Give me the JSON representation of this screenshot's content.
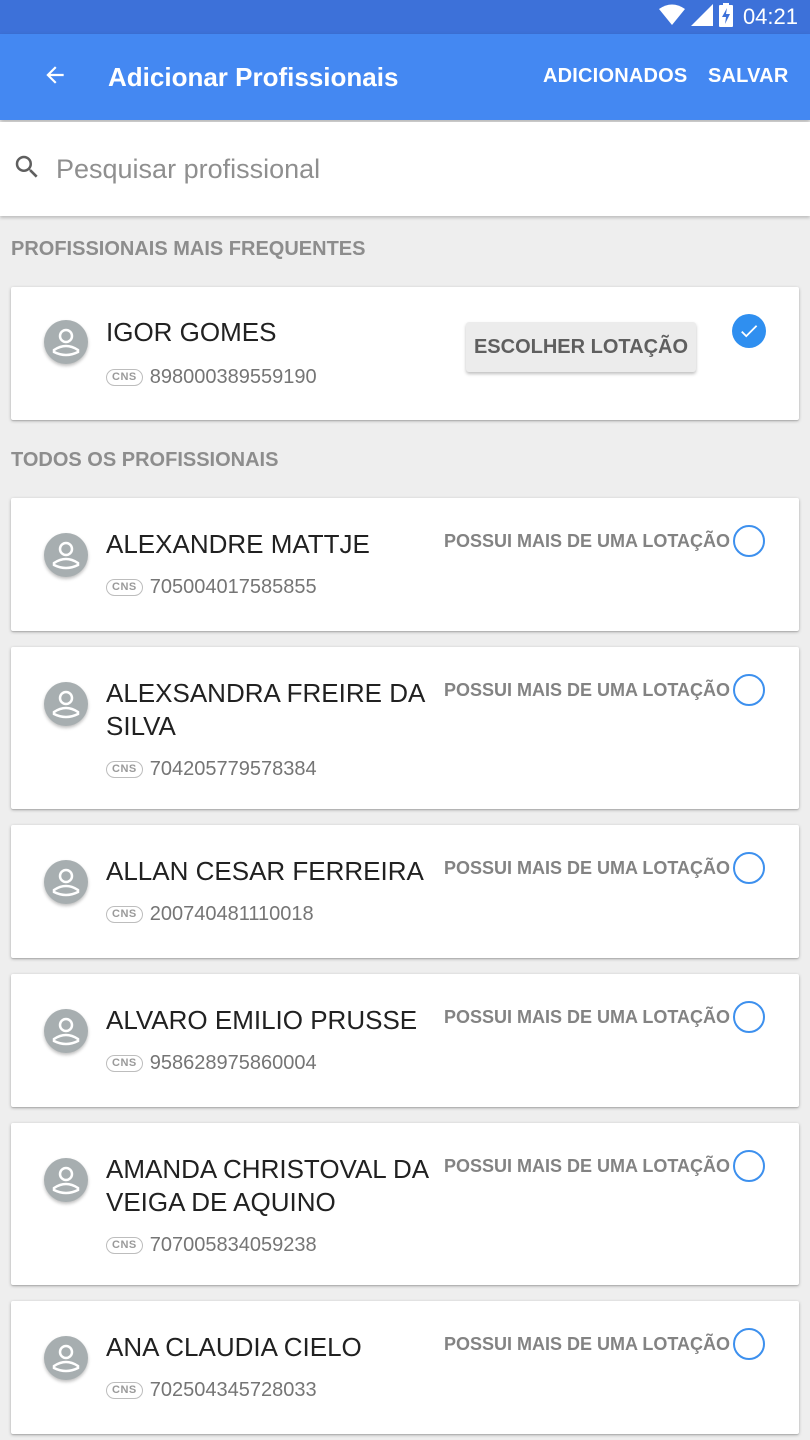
{
  "status_bar": {
    "time": "04:21",
    "icons": [
      "wifi-icon",
      "signal-icon",
      "battery-charging-icon"
    ]
  },
  "app_bar": {
    "back_icon": "arrow-back-icon",
    "title": "Adicionar Profissionais",
    "actions": {
      "added": "ADICIONADOS",
      "save": "SALVAR"
    }
  },
  "search": {
    "icon": "search-icon",
    "placeholder": "Pesquisar profissional",
    "value": ""
  },
  "frequent": {
    "header": "PROFISSIONAIS MAIS FREQUENTES",
    "items": [
      {
        "name": "IGOR GOMES",
        "cns_label": "CNS",
        "cns": "898000389559190",
        "button": "ESCOLHER LOTAÇÃO",
        "selected": true
      }
    ]
  },
  "all": {
    "header": "TODOS OS PROFISSIONAIS",
    "multi_label": "POSSUI MAIS DE UMA LOTAÇÃO",
    "cns_label": "CNS",
    "items": [
      {
        "name": "ALEXANDRE MATTJE",
        "cns": "705004017585855",
        "selected": false
      },
      {
        "name": "ALEXSANDRA FREIRE DA SILVA",
        "cns": "704205779578384",
        "selected": false
      },
      {
        "name": "ALLAN CESAR FERREIRA",
        "cns": "200740481110018",
        "selected": false
      },
      {
        "name": "ALVARO EMILIO PRUSSE",
        "cns": "958628975860004",
        "selected": false
      },
      {
        "name": "AMANDA CHRISTOVAL DA VEIGA DE AQUINO",
        "cns": "707005834059238",
        "selected": false
      },
      {
        "name": "ANA CLAUDIA CIELO",
        "cns": "702504345728033",
        "selected": false
      }
    ]
  },
  "colors": {
    "status_bar": "#3d71d9",
    "app_bar": "#4488f2",
    "accent": "#2f8ff0",
    "background": "#eeeeee"
  }
}
